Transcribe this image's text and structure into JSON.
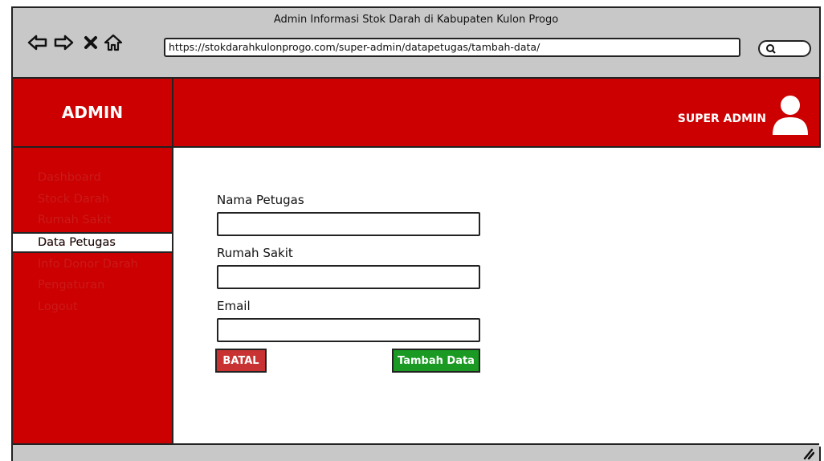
{
  "window": {
    "title": "Admin Informasi Stok Darah di Kabupaten Kulon Progo",
    "url": "https://stokdarahkulonprogo.com/super-admin/datapetugas/tambah-data/"
  },
  "nav_icons": [
    "back-arrow-icon",
    "forward-arrow-icon",
    "close-x-icon",
    "home-icon",
    "search-icon"
  ],
  "header": {
    "brand": "ADMIN",
    "role": "SUPER ADMIN",
    "avatar_icon": "user-icon"
  },
  "sidebar": {
    "items": [
      {
        "label": "Dashboard"
      },
      {
        "label": "Stock Darah"
      },
      {
        "label": "Rumah Sakit"
      },
      {
        "label": "Data Petugas"
      },
      {
        "label": "Info Donor Darah"
      },
      {
        "label": "Pengaturan"
      },
      {
        "label": "Logout"
      }
    ]
  },
  "form": {
    "nama_label": "Nama Petugas",
    "nama_value": "",
    "rs_label": "Rumah Sakit",
    "rs_value": "",
    "email_label": "Email",
    "email_value": "",
    "cancel_label": "BATAL",
    "submit_label": "Tambah Data"
  },
  "colors": {
    "primary": "#cc0000",
    "cancel": "#c83232",
    "submit": "#1a9a22",
    "chrome": "#c8c8c8"
  }
}
